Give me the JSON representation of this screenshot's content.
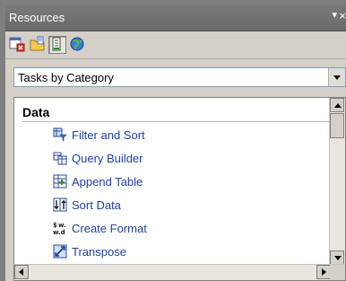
{
  "panel": {
    "title": "Resources",
    "pin_icon": "pin-icon",
    "close_icon": "close-icon"
  },
  "toolbar": {
    "buttons": [
      {
        "icon": "tasks-icon"
      },
      {
        "icon": "folder-icon"
      },
      {
        "icon": "list-view-icon",
        "active": true
      },
      {
        "icon": "globe-icon"
      }
    ]
  },
  "dropdown": {
    "selected": "Tasks by Category"
  },
  "list": {
    "section": "Data",
    "items": [
      {
        "label": "Filter and Sort",
        "icon": "filter-sort-icon"
      },
      {
        "label": "Query Builder",
        "icon": "query-builder-icon"
      },
      {
        "label": "Append Table",
        "icon": "append-table-icon"
      },
      {
        "label": "Sort Data",
        "icon": "sort-data-icon"
      },
      {
        "label": "Create Format",
        "icon": "create-format-icon"
      },
      {
        "label": "Transpose",
        "icon": "transpose-icon"
      }
    ]
  },
  "colors": {
    "titlebar": "#6f6f6f",
    "link": "#1f3fa8",
    "chrome": "#d4d0c8"
  }
}
